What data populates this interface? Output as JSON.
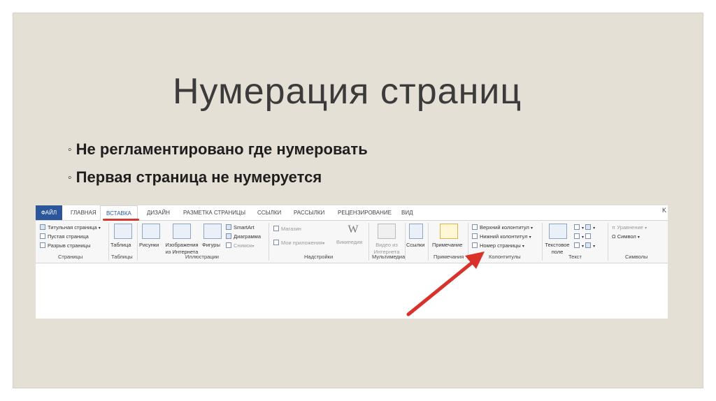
{
  "slide": {
    "title": "Нумерация страниц",
    "bullets": [
      "Не регламентировано где нумеровать",
      "Первая страница не нумеруется"
    ],
    "bullet_mark": "◦"
  },
  "ribbon": {
    "tabs": [
      "ФАЙЛ",
      "ГЛАВНАЯ",
      "ВСТАВКА",
      "ДИЗАЙН",
      "РАЗМЕТКА СТРАНИЦЫ",
      "ССЫЛКИ",
      "РАССЫЛКИ",
      "РЕЦЕНЗИРОВАНИЕ",
      "ВИД"
    ],
    "active_tab": "ВСТАВКА",
    "window_close": "K",
    "pages_group": {
      "items": [
        "Титульная страница",
        "Пустая страница",
        "Разрыв страницы"
      ],
      "label": "Страницы"
    },
    "tables_group": {
      "button": "Таблица",
      "label": "Таблицы"
    },
    "illustrations_group": {
      "buttons": [
        "Рисунки",
        "Изображения из Интернета",
        "Фигуры"
      ],
      "small_items": [
        "SmartArt",
        "Диаграмма",
        "Снимок"
      ],
      "label": "Иллюстрации"
    },
    "addins_group": {
      "items": [
        "Магазин",
        "Мои приложения",
        "Википедия"
      ],
      "label": "Надстройки"
    },
    "media_group": {
      "button": "Видео из Интернета",
      "label": "Мультимедиа"
    },
    "links_group": {
      "button": "Ссылки"
    },
    "comments_group": {
      "button": "Примечание",
      "label": "Примечания"
    },
    "header_footer_group": {
      "items": [
        "Верхний колонтитул",
        "Нижний колонтитул",
        "Номер страницы"
      ],
      "label": "Колонтитулы"
    },
    "text_group": {
      "button": "Текстовое поле",
      "label": "Текст"
    },
    "symbols_group": {
      "items": [
        "Уравнение",
        "Символ"
      ],
      "label": "Символы"
    }
  },
  "colors": {
    "accent": "#2b579a",
    "arrow": "#d8322a",
    "slide_bg": "#e5e0d6"
  }
}
